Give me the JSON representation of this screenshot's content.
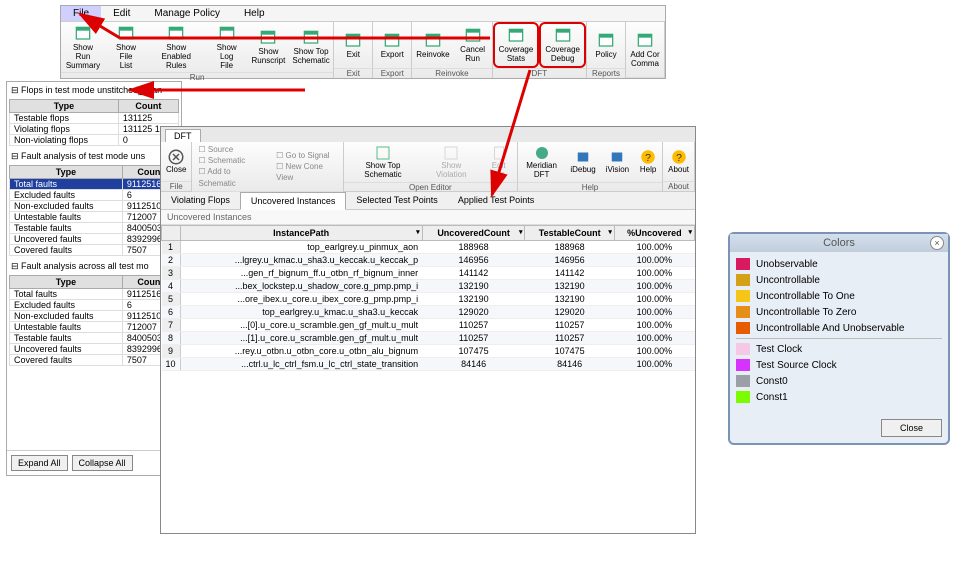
{
  "menubar": [
    "File",
    "Edit",
    "Manage Policy",
    "Help"
  ],
  "ribbon": {
    "groups": [
      {
        "label": "Run",
        "buttons": [
          {
            "name": "show-run-summary",
            "label": "Show Run\nSummary"
          },
          {
            "name": "show-file-list",
            "label": "Show File\nList"
          },
          {
            "name": "show-enabled-rules",
            "label": "Show Enabled\nRules"
          },
          {
            "name": "show-log-file",
            "label": "Show Log\nFile"
          },
          {
            "name": "show-runscript",
            "label": "Show\nRunscript"
          },
          {
            "name": "show-top-schematic",
            "label": "Show Top\nSchematic"
          }
        ]
      },
      {
        "label": "Exit",
        "buttons": [
          {
            "name": "exit",
            "label": "Exit"
          }
        ]
      },
      {
        "label": "Export",
        "buttons": [
          {
            "name": "export",
            "label": "Export"
          }
        ]
      },
      {
        "label": "Reinvoke",
        "buttons": [
          {
            "name": "reinvoke",
            "label": "Reinvoke"
          },
          {
            "name": "cancel-run",
            "label": "Cancel\nRun"
          }
        ]
      },
      {
        "label": "DFT",
        "buttons": [
          {
            "name": "coverage-stats",
            "label": "Coverage\nStats",
            "red": true
          },
          {
            "name": "coverage-debug",
            "label": "Coverage\nDebug",
            "red": true
          }
        ]
      },
      {
        "label": "Reports",
        "buttons": [
          {
            "name": "policy",
            "label": "Policy"
          }
        ]
      },
      {
        "label": "",
        "buttons": [
          {
            "name": "add-comma",
            "label": "Add Cor\nComma"
          }
        ]
      }
    ]
  },
  "tree": {
    "section1": {
      "title": "Flops in test mode unstitched_scan",
      "rows": [
        [
          "Testable flops",
          "131125"
        ],
        [
          "Violating flops",
          "131125  1"
        ],
        [
          "Non-violating flops",
          "0"
        ]
      ]
    },
    "section2": {
      "title": "Fault analysis of test mode uns",
      "rows": [
        [
          "Total faults",
          "9112516",
          true
        ],
        [
          "Excluded faults",
          "6"
        ],
        [
          "Non-excluded faults",
          "9112510"
        ],
        [
          "Untestable faults",
          "712007"
        ],
        [
          "Testable faults",
          "8400503"
        ],
        [
          "Uncovered faults",
          "8392996"
        ],
        [
          "Covered faults",
          "7507"
        ]
      ]
    },
    "section3": {
      "title": "Fault analysis across all test mo",
      "rows": [
        [
          "Total faults",
          "9112516"
        ],
        [
          "Excluded faults",
          "6"
        ],
        [
          "Non-excluded faults",
          "9112510"
        ],
        [
          "Untestable faults",
          "712007"
        ],
        [
          "Testable faults",
          "8400503"
        ],
        [
          "Uncovered faults",
          "8392996"
        ],
        [
          "Covered faults",
          "7507"
        ]
      ]
    },
    "type_hdr": "Type",
    "count_hdr": "Count",
    "expand": "Expand All",
    "collapse": "Collapse All"
  },
  "dft": {
    "tab": "DFT",
    "close": "Close",
    "file_group": "File",
    "view_group": "View",
    "open_group": "Open Editor",
    "help_group": "Help",
    "about_group": "About",
    "small": [
      "Source",
      "Schematic",
      "Add to Schematic"
    ],
    "small2": [
      "Go to Signal",
      "New Cone View"
    ],
    "show_top": "Show Top\nSchematic",
    "show_viol": "Show\nViolation",
    "edit_file": "Edit\nFile",
    "meridian": "Meridian\nDFT",
    "idebug": "iDebug",
    "ivision": "iVision",
    "help": "Help",
    "about": "About",
    "tabs2": [
      "Violating Flops",
      "Uncovered Instances",
      "Selected Test Points",
      "Applied Test Points"
    ],
    "active_tab": 1,
    "subhdr": "Uncovered Instances",
    "columns": [
      "InstancePath",
      "UncoveredCount",
      "TestableCount",
      "%Uncovered"
    ],
    "rows": [
      [
        "top_earlgrey.u_pinmux_aon",
        "188968",
        "188968",
        "100.00%"
      ],
      [
        "...lgrey.u_kmac.u_sha3.u_keccak.u_keccak_p",
        "146956",
        "146956",
        "100.00%"
      ],
      [
        "...gen_rf_bignum_ff.u_otbn_rf_bignum_inner",
        "141142",
        "141142",
        "100.00%"
      ],
      [
        "...bex_lockstep.u_shadow_core.g_pmp.pmp_i",
        "132190",
        "132190",
        "100.00%"
      ],
      [
        "...ore_ibex.u_core.u_ibex_core.g_pmp.pmp_i",
        "132190",
        "132190",
        "100.00%"
      ],
      [
        "top_earlgrey.u_kmac.u_sha3.u_keccak",
        "129020",
        "129020",
        "100.00%"
      ],
      [
        "...[0].u_core.u_scramble.gen_gf_mult.u_mult",
        "110257",
        "110257",
        "100.00%"
      ],
      [
        "...[1].u_core.u_scramble.gen_gf_mult.u_mult",
        "110257",
        "110257",
        "100.00%"
      ],
      [
        "...rey.u_otbn.u_otbn_core.u_otbn_alu_bignum",
        "107475",
        "107475",
        "100.00%"
      ],
      [
        "...ctrl.u_lc_ctrl_fsm.u_lc_ctrl_state_transition",
        "84146",
        "84146",
        "100.00%"
      ]
    ]
  },
  "colors": {
    "title": "Colors",
    "items": [
      {
        "c": "#d81b60",
        "t": "Unobservable"
      },
      {
        "c": "#d4a017",
        "t": "Uncontrollable"
      },
      {
        "c": "#f5c518",
        "t": "Uncontrollable To One"
      },
      {
        "c": "#e58e1a",
        "t": "Uncontrollable To Zero"
      },
      {
        "c": "#e65c00",
        "t": "Uncontrollable And Unobservable"
      },
      {
        "c": "#f5c9e6",
        "t": "Test Clock"
      },
      {
        "c": "#d633ff",
        "t": "Test Source Clock"
      },
      {
        "c": "#9aa0a6",
        "t": "Const0"
      },
      {
        "c": "#7cfc00",
        "t": "Const1"
      }
    ],
    "close": "Close"
  }
}
